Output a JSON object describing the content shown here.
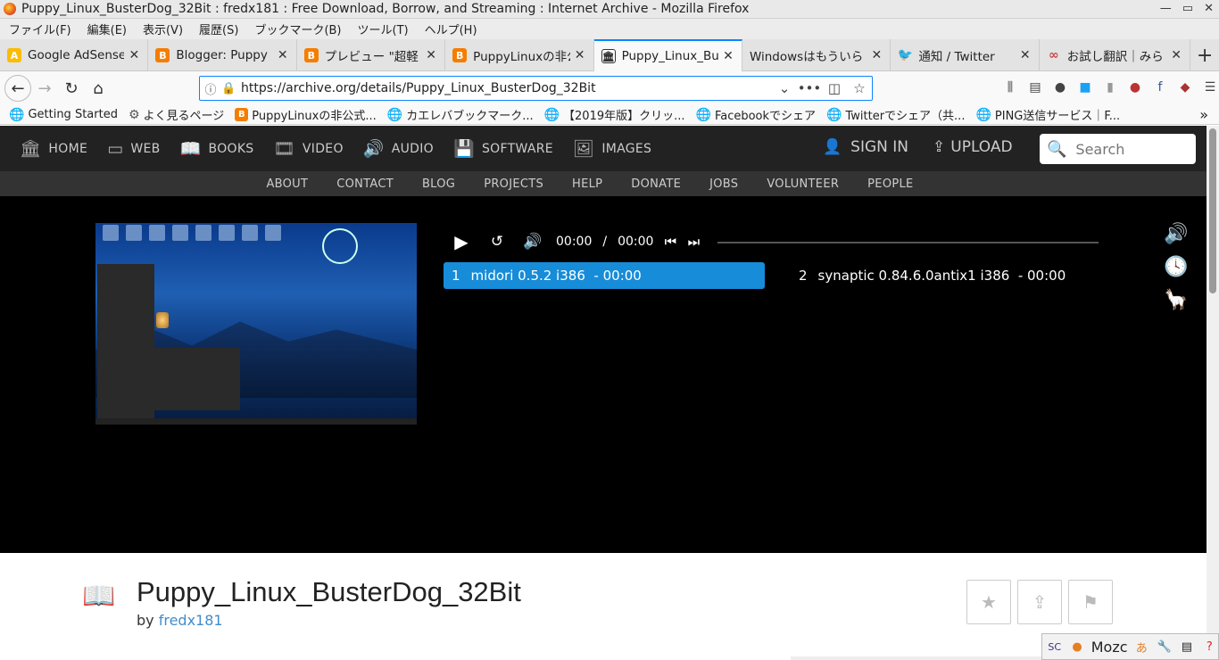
{
  "window": {
    "title": "Puppy_Linux_BusterDog_32Bit : fredx181 : Free Download, Borrow, and Streaming : Internet Archive - Mozilla Firefox",
    "controls": [
      "—",
      "▭",
      "✕"
    ]
  },
  "menubar": [
    "ファイル(F)",
    "編集(E)",
    "表示(V)",
    "履歴(S)",
    "ブックマーク(B)",
    "ツール(T)",
    "ヘルプ(H)"
  ],
  "tabs": [
    {
      "label": "Google AdSense",
      "icon_color": "#fbbc05",
      "icon_glyph": "A"
    },
    {
      "label": "Blogger: Puppy",
      "icon_color": "#f57d00",
      "icon_glyph": "B"
    },
    {
      "label": "プレビュー \"超軽",
      "icon_color": "#f57d00",
      "icon_glyph": "B"
    },
    {
      "label": "PuppyLinuxの非公",
      "icon_color": "#f57d00",
      "icon_glyph": "B"
    },
    {
      "label": "Puppy_Linux_Bu",
      "icon_color": "#333333",
      "icon_glyph": "🏛",
      "active": true
    },
    {
      "label": "Windowsはもういら",
      "icon_color": "",
      "icon_glyph": ""
    },
    {
      "label": "通知 / Twitter",
      "icon_color": "#1da1f2",
      "icon_glyph": "🐦"
    },
    {
      "label": "お試し翻訳｜みら",
      "icon_color": "#c44",
      "icon_glyph": "∞"
    }
  ],
  "url": "https://archive.org/details/Puppy_Linux_BusterDog_32Bit",
  "bookmarks": [
    {
      "label": "Getting Started",
      "icon": "globe"
    },
    {
      "label": "よく見るページ",
      "icon": "gear"
    },
    {
      "label": "PuppyLinuxの非公式...",
      "icon": "blogger"
    },
    {
      "label": "カエレバブックマーク...",
      "icon": "globe"
    },
    {
      "label": "【2019年版】クリッ...",
      "icon": "globe"
    },
    {
      "label": "Facebookでシェア",
      "icon": "globe"
    },
    {
      "label": "Twitterでシェア（共...",
      "icon": "globe"
    },
    {
      "label": "PING送信サービス｜F...",
      "icon": "globe"
    }
  ],
  "topnav": {
    "items": [
      {
        "label": "HOME",
        "icon": "archive-icon"
      },
      {
        "label": "WEB",
        "icon": "web-icon"
      },
      {
        "label": "BOOKS",
        "icon": "books-icon"
      },
      {
        "label": "VIDEO",
        "icon": "video-icon"
      },
      {
        "label": "AUDIO",
        "icon": "audio-icon"
      },
      {
        "label": "SOFTWARE",
        "icon": "software-icon"
      },
      {
        "label": "IMAGES",
        "icon": "images-icon"
      }
    ],
    "signin": "SIGN IN",
    "upload": "UPLOAD",
    "search_placeholder": "Search"
  },
  "subnav": [
    "ABOUT",
    "CONTACT",
    "BLOG",
    "PROJECTS",
    "HELP",
    "DONATE",
    "JOBS",
    "VOLUNTEER",
    "PEOPLE"
  ],
  "player": {
    "current_time": "00:00",
    "separator": "/",
    "duration": "00:00",
    "playlist": [
      {
        "num": "1",
        "title": "midori 0.5.2 i386",
        "time": "- 00:00"
      },
      {
        "num": "2",
        "title": "synaptic 0.84.6.0antix1 i386",
        "time": "- 00:00"
      }
    ]
  },
  "item": {
    "title": "Puppy_Linux_BusterDog_32Bit",
    "by": "by",
    "author": "fredx181"
  },
  "mozc": {
    "label": "Mozc"
  },
  "colors": {
    "accent": "#178cd8",
    "nav_bg": "#222222",
    "subnav_bg": "#333333",
    "link": "#428bca",
    "book_icon": "#f0a030"
  }
}
